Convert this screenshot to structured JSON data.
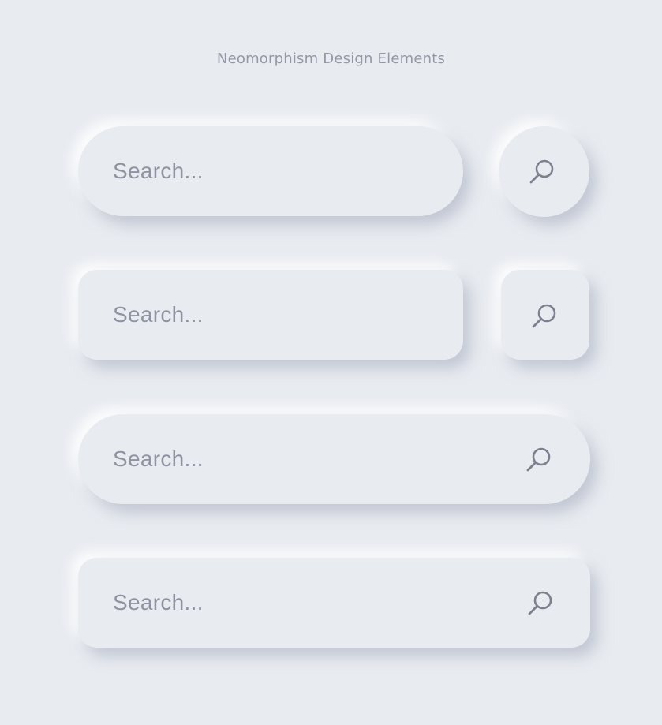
{
  "page": {
    "title": "Neomorphism Design Elements",
    "background_color": "#e8ebf0",
    "text_color": "#8d93a0"
  },
  "rows": [
    {
      "variant": "pill-bar-with-round-button",
      "placeholder": "Search...",
      "icon": "search-icon"
    },
    {
      "variant": "rounded-rect-bar-with-square-button",
      "placeholder": "Search...",
      "icon": "search-icon"
    },
    {
      "variant": "pill-bar-with-inline-icon",
      "placeholder": "Search...",
      "icon": "search-icon"
    },
    {
      "variant": "rounded-rect-bar-with-inline-icon",
      "placeholder": "Search...",
      "icon": "search-icon"
    }
  ]
}
